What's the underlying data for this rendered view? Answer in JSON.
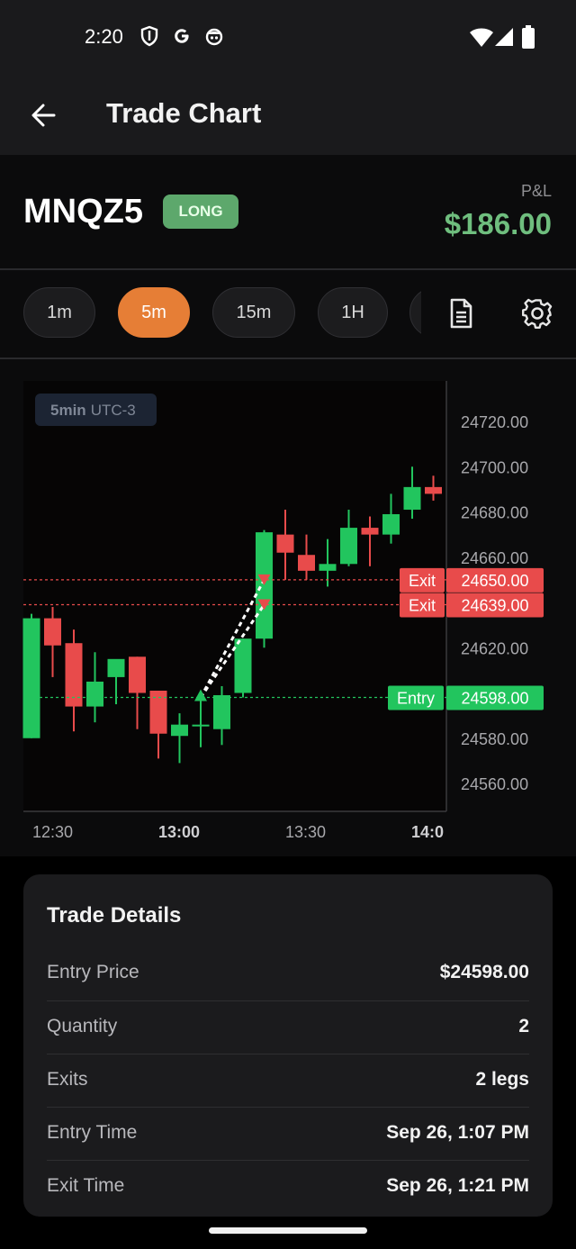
{
  "status_bar": {
    "time": "2:20"
  },
  "app_bar": {
    "title": "Trade Chart"
  },
  "header": {
    "symbol": "MNQZ5",
    "side": "LONG",
    "pnl_label": "P&L",
    "pnl_value": "$186.00"
  },
  "timeframes": [
    {
      "label": "1m",
      "active": false
    },
    {
      "label": "5m",
      "active": true
    },
    {
      "label": "15m",
      "active": false
    },
    {
      "label": "1H",
      "active": false
    }
  ],
  "chart": {
    "interval_bold": "5min",
    "timezone": "UTC-3",
    "x_labels": [
      {
        "text": "12:30",
        "bold": false
      },
      {
        "text": "13:00",
        "bold": true
      },
      {
        "text": "13:30",
        "bold": false
      },
      {
        "text": "14:0",
        "bold": true
      }
    ],
    "price_lines": [
      {
        "tag": "Exit",
        "price": "24650.00",
        "value": 24650,
        "color": "#e84b4b"
      },
      {
        "tag": "Exit",
        "price": "24639.00",
        "value": 24639,
        "color": "#e84b4b"
      },
      {
        "tag": "Entry",
        "price": "24598.00",
        "value": 24598,
        "color": "#22c55e"
      }
    ]
  },
  "chart_data": {
    "type": "candlestick",
    "y_ticks": [
      "24720.00",
      "24700.00",
      "24680.00",
      "24660.00",
      "24620.00",
      "24580.00",
      "24560.00"
    ],
    "y_tick_values": [
      24720,
      24700,
      24680,
      24660,
      24620,
      24580,
      24560
    ],
    "candles": [
      {
        "o": 24580,
        "h": 24635,
        "l": 24580,
        "c": 24633
      },
      {
        "o": 24633,
        "h": 24638,
        "l": 24607,
        "c": 24621
      },
      {
        "o": 24622,
        "h": 24628,
        "l": 24583,
        "c": 24594
      },
      {
        "o": 24594,
        "h": 24618,
        "l": 24587,
        "c": 24605
      },
      {
        "o": 24607,
        "h": 24614,
        "l": 24595,
        "c": 24615
      },
      {
        "o": 24616,
        "h": 24616,
        "l": 24584,
        "c": 24600
      },
      {
        "o": 24601,
        "h": 24601,
        "l": 24571,
        "c": 24582
      },
      {
        "o": 24581,
        "h": 24591,
        "l": 24569,
        "c": 24586
      },
      {
        "o": 24586,
        "h": 24597,
        "l": 24576,
        "c": 24586
      },
      {
        "o": 24584,
        "h": 24603,
        "l": 24577,
        "c": 24599
      },
      {
        "o": 24600,
        "h": 24624,
        "l": 24598,
        "c": 24624
      },
      {
        "o": 24624,
        "h": 24672,
        "l": 24620,
        "c": 24671
      },
      {
        "o": 24670,
        "h": 24681,
        "l": 24650,
        "c": 24662
      },
      {
        "o": 24661,
        "h": 24670,
        "l": 24650,
        "c": 24654
      },
      {
        "o": 24654,
        "h": 24668,
        "l": 24647,
        "c": 24657
      },
      {
        "o": 24657,
        "h": 24681,
        "l": 24656,
        "c": 24673
      },
      {
        "o": 24673,
        "h": 24678,
        "l": 24656,
        "c": 24670
      },
      {
        "o": 24670,
        "h": 24688,
        "l": 24666,
        "c": 24679
      },
      {
        "o": 24681,
        "h": 24700,
        "l": 24677,
        "c": 24691
      },
      {
        "o": 24691,
        "h": 24696,
        "l": 24685,
        "c": 24688
      }
    ],
    "entry_marker": {
      "candle": 8,
      "price": 24598
    },
    "exit_markers": [
      {
        "candle": 11,
        "price": 24650
      },
      {
        "candle": 11,
        "price": 24639
      }
    ]
  },
  "details": {
    "title": "Trade Details",
    "rows": [
      {
        "label": "Entry Price",
        "value": "$24598.00"
      },
      {
        "label": "Quantity",
        "value": "2"
      },
      {
        "label": "Exits",
        "value": "2 legs"
      },
      {
        "label": "Entry Time",
        "value": "Sep 26, 1:07 PM"
      },
      {
        "label": "Exit Time",
        "value": "Sep 26, 1:21 PM"
      }
    ]
  },
  "colors": {
    "up": "#22c55e",
    "down": "#e84b4b",
    "accent": "#e67e36",
    "profit": "#6fbe7e"
  }
}
